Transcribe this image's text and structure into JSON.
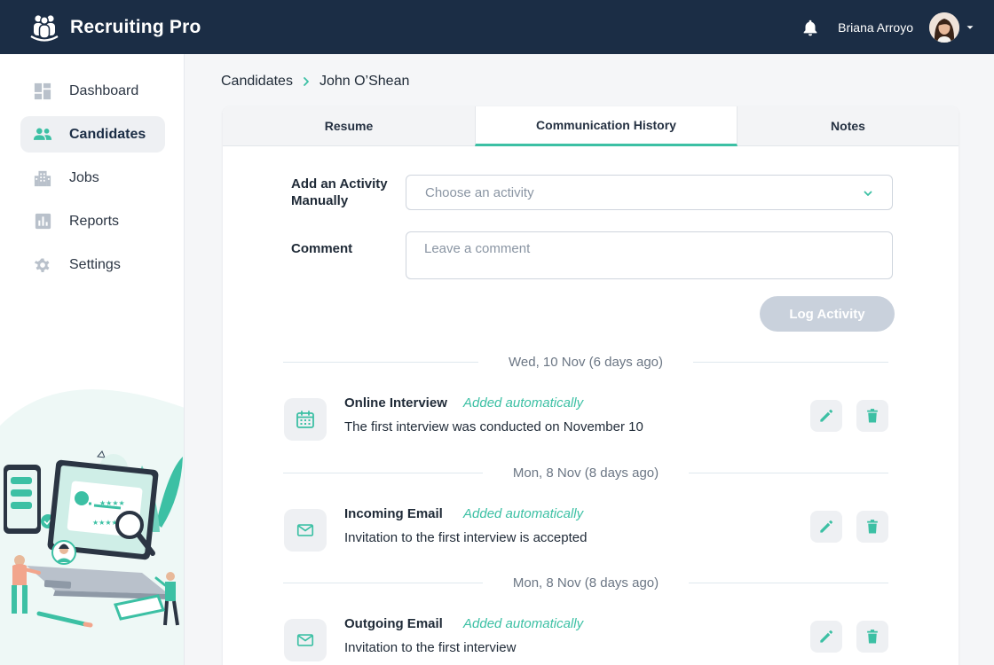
{
  "app": {
    "name": "Recruiting Pro"
  },
  "user": {
    "name": "Briana Arroyo"
  },
  "sidebar": {
    "items": [
      {
        "label": "Dashboard",
        "icon": "dashboard-icon"
      },
      {
        "label": "Candidates",
        "icon": "people-icon",
        "active": true
      },
      {
        "label": "Jobs",
        "icon": "building-icon"
      },
      {
        "label": "Reports",
        "icon": "bar-chart-icon"
      },
      {
        "label": "Settings",
        "icon": "gear-icon"
      }
    ]
  },
  "breadcrumb": {
    "parent": "Candidates",
    "current": "John O’Shean"
  },
  "tabs": [
    {
      "label": "Resume"
    },
    {
      "label": "Communication History",
      "active": true
    },
    {
      "label": "Notes"
    }
  ],
  "form": {
    "activity_label": "Add an Activity Manually",
    "activity_placeholder": "Choose an activity",
    "comment_label": "Comment",
    "comment_placeholder": "Leave a comment",
    "submit_label": "Log Activity"
  },
  "history": [
    {
      "date": "Wed, 10 Nov (6 days ago)",
      "title": "Online Interview",
      "source": "Added automatically",
      "description": "The first interview was conducted on November 10",
      "icon": "calendar-icon"
    },
    {
      "date": "Mon, 8 Nov (8 days ago)",
      "title": "Incoming Email",
      "source": "Added automatically",
      "description": "Invitation to the first interview is accepted",
      "icon": "mail-icon"
    },
    {
      "date": "Mon, 8 Nov (8 days ago)",
      "title": "Outgoing Email",
      "source": "Added automatically",
      "description": "Invitation to the first interview",
      "icon": "mail-icon"
    }
  ],
  "colors": {
    "header": "#1b2d45",
    "accent": "#3cc0a4",
    "button_disabled": "#c9d1dc"
  }
}
